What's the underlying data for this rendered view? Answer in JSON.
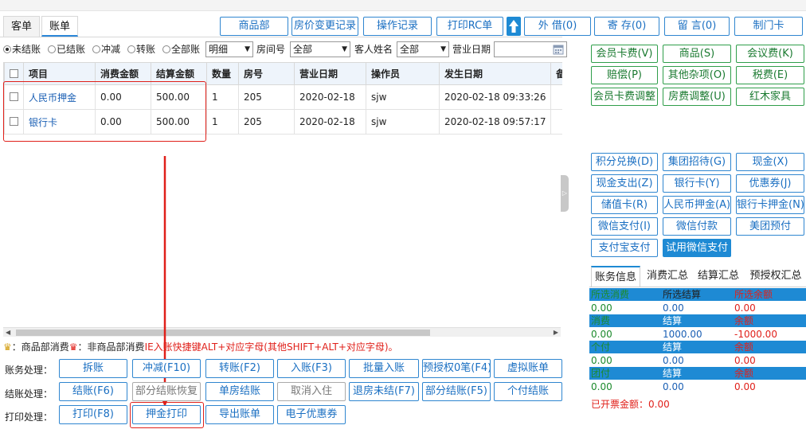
{
  "tabs": [
    {
      "label": "客单"
    },
    {
      "label": "账单"
    }
  ],
  "toolbar": {
    "buttons": [
      "商品部",
      "房价变更记录",
      "操作记录",
      "打印RC单",
      "外 借(0)",
      "寄 存(0)",
      "留 言(0)",
      "制门卡"
    ],
    "up_icon": "up-arrow-icon"
  },
  "filters": {
    "radios": [
      {
        "label": "未结账",
        "checked": true
      },
      {
        "label": "已结账",
        "checked": false
      },
      {
        "label": "冲减",
        "checked": false
      },
      {
        "label": "转账",
        "checked": false
      },
      {
        "label": "全部账",
        "checked": false
      }
    ],
    "detail_select": "明细",
    "room_label": "房间号",
    "room_select": "全部",
    "guest_label": "客人姓名",
    "guest_select": "全部",
    "date_label": "营业日期",
    "date_value": ""
  },
  "table": {
    "headers": [
      "项目",
      "消费金额",
      "结算金额",
      "数量",
      "房号",
      "营业日期",
      "操作员",
      "发生日期",
      "备"
    ],
    "rows": [
      {
        "item": "人民币押金",
        "consume": "0.00",
        "settle": "500.00",
        "qty": "1",
        "room": "205",
        "bizdate": "2020-02-18",
        "operator": "sjw",
        "time": "2020-02-18 09:33:26"
      },
      {
        "item": "银行卡",
        "consume": "0.00",
        "settle": "500.00",
        "qty": "1",
        "room": "205",
        "bizdate": "2020-02-18",
        "operator": "sjw",
        "time": "2020-02-18 09:57:17"
      }
    ]
  },
  "legend": {
    "part1": "：商品部消费",
    "part2": "：非商品部消费",
    "part3": "IE入账快捷键ALT+对应字母(其他SHIFT+ALT+对应字母)。"
  },
  "actions": {
    "account_label": "账务处理：",
    "account": [
      "拆账",
      "冲减(F10)",
      "转账(F2)",
      "入账(F3)",
      "批量入账",
      "预授权0笔(F4)",
      "虚拟账单"
    ],
    "settle_label": "结账处理：",
    "settle": [
      "结账(F6)",
      "部分结账恢复",
      "单房结账",
      "取消入住",
      "退房未结(F7)",
      "部分结账(F5)",
      "个付结账"
    ],
    "print_label": "打印处理：",
    "print": [
      "打印(F8)",
      "押金打印",
      "导出账单",
      "电子优惠券"
    ]
  },
  "charge_buttons": [
    "会员卡费(V)",
    "商品(S)",
    "会议费(K)",
    "赔偿(P)",
    "其他杂项(O)",
    "税费(E)",
    "会员卡费调整",
    "房费调整(U)",
    "红木家具"
  ],
  "payment_buttons": [
    "积分兑换(D)",
    "集团招待(G)",
    "现金(X)",
    "现金支出(Z)",
    "银行卡(Y)",
    "优惠券(J)",
    "储值卡(R)",
    "人民币押金(A)",
    "银行卡押金(N)",
    "微信支付(I)",
    "微信付款",
    "美团预付",
    "支付宝支付",
    "试用微信支付"
  ],
  "summary": {
    "tabs": [
      "账务信息",
      "消费汇总",
      "结算汇总",
      "预授权汇总"
    ],
    "h1": [
      "所选消费",
      "所选结算",
      "所选余额"
    ],
    "v1": [
      "0.00",
      "0.00",
      "0.00"
    ],
    "h2": [
      "消费",
      "结算",
      "余额"
    ],
    "v2": [
      "0.00",
      "1000.00",
      "-1000.00"
    ],
    "h3": [
      "个付",
      "结算",
      "余额"
    ],
    "v3": [
      "0.00",
      "0.00",
      "0.00"
    ],
    "h4": [
      "团付",
      "结算",
      "余额"
    ],
    "v4": [
      "0.00",
      "0.00",
      "0.00"
    ],
    "invoiced_label": "已开票金额：",
    "invoiced_value": "0.00"
  },
  "colors": {
    "accent": "#1e8ad4",
    "highlight": "#e0201a",
    "green": "#1c8a2c"
  }
}
